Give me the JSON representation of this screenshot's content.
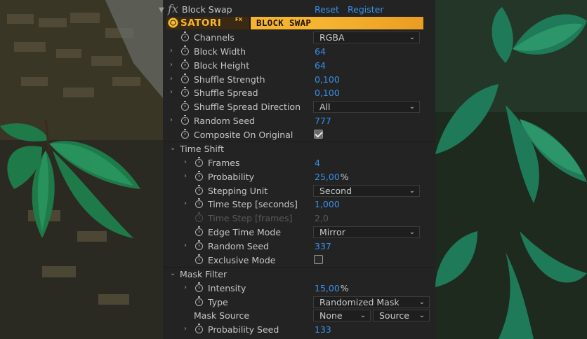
{
  "effect": {
    "fx_glyph": "fx",
    "name": "Block Swap",
    "reset_label": "Reset",
    "register_label": "Register",
    "banner_brand": "SATORI",
    "banner_brand_sup": "FX",
    "banner_effect": "BLOCK SWAP"
  },
  "params": {
    "channels": {
      "label": "Channels",
      "value": "RGBA"
    },
    "block_width": {
      "label": "Block Width",
      "value": "64"
    },
    "block_height": {
      "label": "Block Height",
      "value": "64"
    },
    "shuffle_strength": {
      "label": "Shuffle Strength",
      "value": "0,100"
    },
    "shuffle_spread": {
      "label": "Shuffle Spread",
      "value": "0,100"
    },
    "shuffle_spread_direction": {
      "label": "Shuffle Spread Direction",
      "value": "All"
    },
    "random_seed": {
      "label": "Random Seed",
      "value": "777"
    },
    "composite_on_original": {
      "label": "Composite On Original",
      "checked": true
    }
  },
  "time_shift": {
    "label": "Time Shift",
    "frames": {
      "label": "Frames",
      "value": "4"
    },
    "probability": {
      "label": "Probability",
      "value": "25,00",
      "unit": "%"
    },
    "stepping_unit": {
      "label": "Stepping Unit",
      "value": "Second"
    },
    "time_step_seconds": {
      "label": "Time Step [seconds]",
      "value": "1,000"
    },
    "time_step_frames": {
      "label": "Time Step [frames]",
      "value": "2,0"
    },
    "edge_time_mode": {
      "label": "Edge Time Mode",
      "value": "Mirror"
    },
    "random_seed": {
      "label": "Random Seed",
      "value": "337"
    },
    "exclusive_mode": {
      "label": "Exclusive Mode",
      "checked": false
    }
  },
  "mask_filter": {
    "label": "Mask Filter",
    "intensity": {
      "label": "Intensity",
      "value": "15,00",
      "unit": "%"
    },
    "type": {
      "label": "Type",
      "value": "Randomized Mask"
    },
    "mask_source": {
      "label": "Mask Source",
      "layer_value": "None",
      "channel_value": "Source"
    },
    "probability_seed": {
      "label": "Probability Seed",
      "value": "133"
    }
  },
  "colors": {
    "panel_bg": "#232323",
    "value_blue": "#3a8ee6",
    "banner_orange": "#f5b531"
  }
}
